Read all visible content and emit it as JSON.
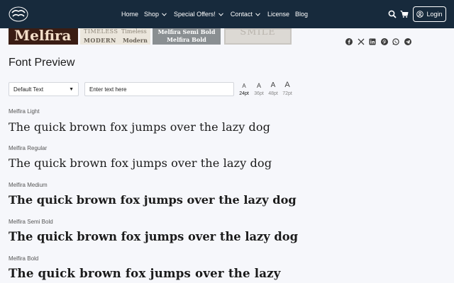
{
  "header": {
    "logo_icon": "store-logo-icon",
    "nav": [
      {
        "label": "Home",
        "dropdown": false
      },
      {
        "label": "Shop",
        "dropdown": true
      },
      {
        "label": "Special Offers!",
        "dropdown": true
      },
      {
        "label": "Contact",
        "dropdown": true
      },
      {
        "label": "License",
        "dropdown": false
      },
      {
        "label": "Blog",
        "dropdown": false
      }
    ],
    "login_label": "Login",
    "background": "#172a3c"
  },
  "thumbnails": {
    "t1": "Melfira",
    "t2_a": "TIMELESS",
    "t2_b": "Timeless",
    "t2_c": "MODERN",
    "t2_d": "Modern",
    "t3_a": "Melfira Semi Bold",
    "t3_b": "Melfira Bold",
    "t4": "SMILE"
  },
  "share": [
    "facebook-icon",
    "x-icon",
    "linkedin-icon",
    "pinterest-icon",
    "whatsapp-icon",
    "telegram-icon"
  ],
  "preview": {
    "title": "Font Preview",
    "select_value": "Default Text",
    "input_placeholder": "Enter text here",
    "sizes": [
      "24pt",
      "36pt",
      "48pt",
      "72pt"
    ],
    "size_glyph": "A",
    "active_size": "24pt"
  },
  "samples": [
    {
      "name": "Melfira Light",
      "text": "The quick brown fox jumps over the lazy dog"
    },
    {
      "name": "Melfira Regular",
      "text": "The quick brown fox jumps over the lazy dog"
    },
    {
      "name": "Melfira Medium",
      "text": "The quick brown fox jumps over the lazy dog"
    },
    {
      "name": "Melfira Semi Bold",
      "text": "The quick brown fox jumps over the lazy dog"
    },
    {
      "name": "Melfira Bold",
      "text": "The quick brown fox jumps over the lazy"
    }
  ]
}
